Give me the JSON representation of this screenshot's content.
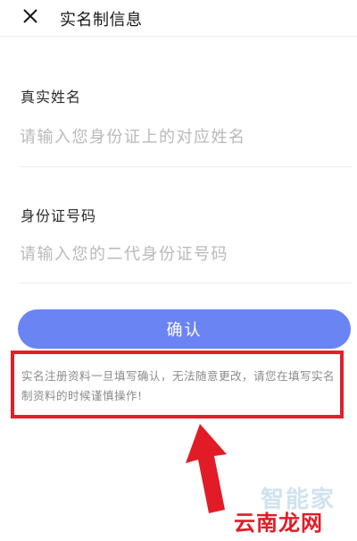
{
  "header": {
    "close_icon": "close-icon",
    "title": "实名制信息"
  },
  "form": {
    "name_label": "真实姓名",
    "name_placeholder": "请输入您身份证上的对应姓名",
    "id_label": "身份证号码",
    "id_placeholder": "请输入您的二代身份证号码"
  },
  "confirm_button": "确认",
  "notice": "实名注册资料一旦填写确认，无法随意更改，请您在填写实名制资料的时候谨慎操作!",
  "annotation": {
    "highlight_color": "#e0202a",
    "arrow_icon": "arrow-up-icon"
  },
  "watermarks": {
    "top": "智能家",
    "bottom": "云南龙网"
  }
}
